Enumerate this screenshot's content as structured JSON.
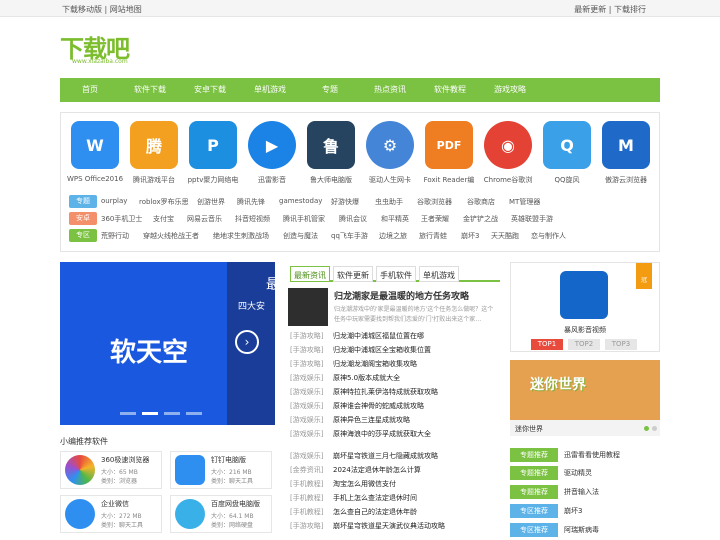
{
  "topbar": {
    "left": "下载移动版 | 网站地图",
    "right": "最新更新 | 下载排行"
  },
  "logo": {
    "text": "下载吧",
    "url": "www.xiazaiba.com"
  },
  "nav": [
    "首页",
    "软件下载",
    "安卓下载",
    "单机游戏",
    "专题",
    "热点资讯",
    "软件教程",
    "游戏攻略"
  ],
  "apps": [
    {
      "name": "WPS Office2016",
      "color": "#2e8ff0",
      "icon": "W"
    },
    {
      "name": "腾讯游戏平台",
      "color": "#f3a020",
      "icon": "腾"
    },
    {
      "name": "pptv聚力网络电",
      "color": "#1d8fe1",
      "icon": "P"
    },
    {
      "name": "迅雷影音",
      "color": "#1b82e6",
      "icon": "▶"
    },
    {
      "name": "鲁大师电脑版",
      "color": "#26445f",
      "icon": "鲁"
    },
    {
      "name": "驱动人生网卡",
      "color": "#4585d8",
      "icon": "⚙"
    },
    {
      "name": "Foxit Reader编",
      "color": "#ef7d21",
      "icon": "PDF"
    },
    {
      "name": "Chrome谷歌浏",
      "color": "#e34234",
      "icon": "◉"
    },
    {
      "name": "QQ旋风",
      "color": "#3aa0e8",
      "icon": "Q"
    },
    {
      "name": "傲游云浏览器",
      "color": "#1f69c8",
      "icon": "M"
    }
  ],
  "tag_rows": [
    {
      "tag": "专题",
      "color": "#5db3e8",
      "items": [
        "ourplay",
        "roblox罗布乐思",
        "创游世界",
        "腾讯先锋",
        "gamestoday",
        "好游快爆",
        "虫虫助手",
        "谷歌浏览器",
        "谷歌商店",
        "MT管理器"
      ]
    },
    {
      "tag": "安卓",
      "color": "#f38f6a",
      "items": [
        "360手机卫士",
        "支付宝",
        "网易云音乐",
        "抖音短视频",
        "腾讯手机管家",
        "腾讯会议",
        "和平精英",
        "王者荣耀",
        "金铲铲之战",
        "英雄联盟手游"
      ]
    },
    {
      "tag": "专区",
      "color": "#7bc142",
      "items": [
        "荒野行动",
        "穿越火线枪战王者",
        "绝地求生刺激战场",
        "创造与魔法",
        "qq飞车手游",
        "边境之旅",
        "旅行青蛙",
        "崩坏3",
        "天天酷跑",
        "恋与制作人"
      ]
    }
  ],
  "banner": {
    "title": "软天空",
    "right_text": "四大安",
    "right_top": "最"
  },
  "recommend_title": "小编推荐软件",
  "softs": [
    {
      "name": "360极速浏览器",
      "size": "大小：65 MB",
      "cat": "类别：浏览器",
      "color": "#e96a3d"
    },
    {
      "name": "钉钉电脑版",
      "size": "大小：216 MB",
      "cat": "类别：聊天工具",
      "color": "#2f8ff0"
    },
    {
      "name": "企业微信",
      "size": "大小：272 MB",
      "cat": "类别：聊天工具",
      "color": "#2f8ff0"
    },
    {
      "name": "百度网盘电脑版",
      "size": "大小：64.1 MB",
      "cat": "类别：网络硬盘",
      "color": "#3ab0e8"
    }
  ],
  "tabs": [
    "最新资讯",
    "软件更新",
    "手机软件",
    "单机游戏"
  ],
  "featured": {
    "title": "归龙潮家是最温暖的地方任务攻略",
    "desc": "归龙潮游戏中的'家是最温暖的地方'这个任务怎么做呢？这个任务中玩家需要找到帮我们恋爱的'门'打败出来这个家…"
  },
  "news": [
    {
      "cat": "[手游攻略]",
      "title": "归龙潮中浦城区福鼠位置在哪"
    },
    {
      "cat": "[手游攻略]",
      "title": "归龙潮中浦城区全宝箱收集位置"
    },
    {
      "cat": "[手游攻略]",
      "title": "归龙潮龙潮阁宝箱收集攻略"
    },
    {
      "cat": "[游戏娱乐]",
      "title": "原神5.0版本成就大全"
    },
    {
      "cat": "[游戏娱乐]",
      "title": "原神特拉扎莱伊洛特成就获取攻略"
    },
    {
      "cat": "[游戏娱乐]",
      "title": "原神谁会神骨的蛇威成就攻略"
    },
    {
      "cat": "[游戏娱乐]",
      "title": "原神异色三连星成就攻略"
    },
    {
      "cat": "[游戏娱乐]",
      "title": "原神海浪中的莎孚成就获取大全"
    },
    {
      "cat": "[游戏娱乐]",
      "title": "崩坏星穹铁道三月七隐藏成就攻略"
    },
    {
      "cat": "[金券资讯]",
      "title": "2024法定退休年龄怎么计算"
    },
    {
      "cat": "[手机教程]",
      "title": "淘宝怎么用微信支付"
    },
    {
      "cat": "[手机教程]",
      "title": "手机上怎么查法定退休时间"
    },
    {
      "cat": "[手机教程]",
      "title": "怎么查自己的法定退休年龄"
    },
    {
      "cat": "[手游攻略]",
      "title": "崩坏星穹铁道星天演武仪典活动攻略"
    }
  ],
  "rank": {
    "name": "暴风影音视频",
    "medal": "冠",
    "tabs": [
      "TOP1",
      "TOP2",
      "TOP3"
    ]
  },
  "game": {
    "banner_text": "迷你世界",
    "caption": "迷你世界"
  },
  "rec_list": [
    {
      "tag": "专题推荐",
      "value": "迅雷看看使用教程"
    },
    {
      "tag": "专题推荐",
      "value": "驱动精灵"
    },
    {
      "tag": "专题推荐",
      "value": "拼音输入法"
    },
    {
      "tag": "专区推荐",
      "value": "崩坏3"
    },
    {
      "tag": "专区推荐",
      "value": "阿瑞斯病毒"
    }
  ]
}
